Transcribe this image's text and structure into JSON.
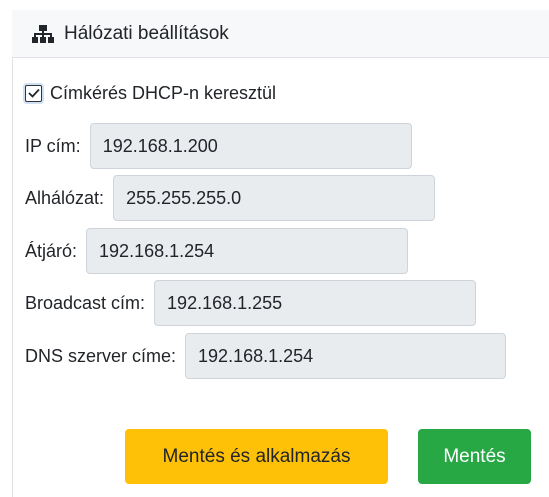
{
  "header": {
    "icon": "network-icon",
    "title": "Hálózati beállítások"
  },
  "dhcp": {
    "checked": true,
    "label": "Címkérés DHCP-n keresztül"
  },
  "fields": {
    "ip": {
      "label": "IP cím:",
      "value": "192.168.1.200"
    },
    "subnet": {
      "label": "Alhálózat:",
      "value": "255.255.255.0"
    },
    "gateway": {
      "label": "Átjáró:",
      "value": "192.168.1.254"
    },
    "broadcast": {
      "label": "Broadcast cím:",
      "value": "192.168.1.255"
    },
    "dns": {
      "label": "DNS szerver címe:",
      "value": "192.168.1.254"
    }
  },
  "buttons": {
    "save_apply": "Mentés és alkalmazás",
    "save": "Mentés"
  },
  "colors": {
    "warning": "#ffc107",
    "success": "#28a745",
    "input_bg": "#e9ecef",
    "header_bg": "#f7f8fa"
  }
}
